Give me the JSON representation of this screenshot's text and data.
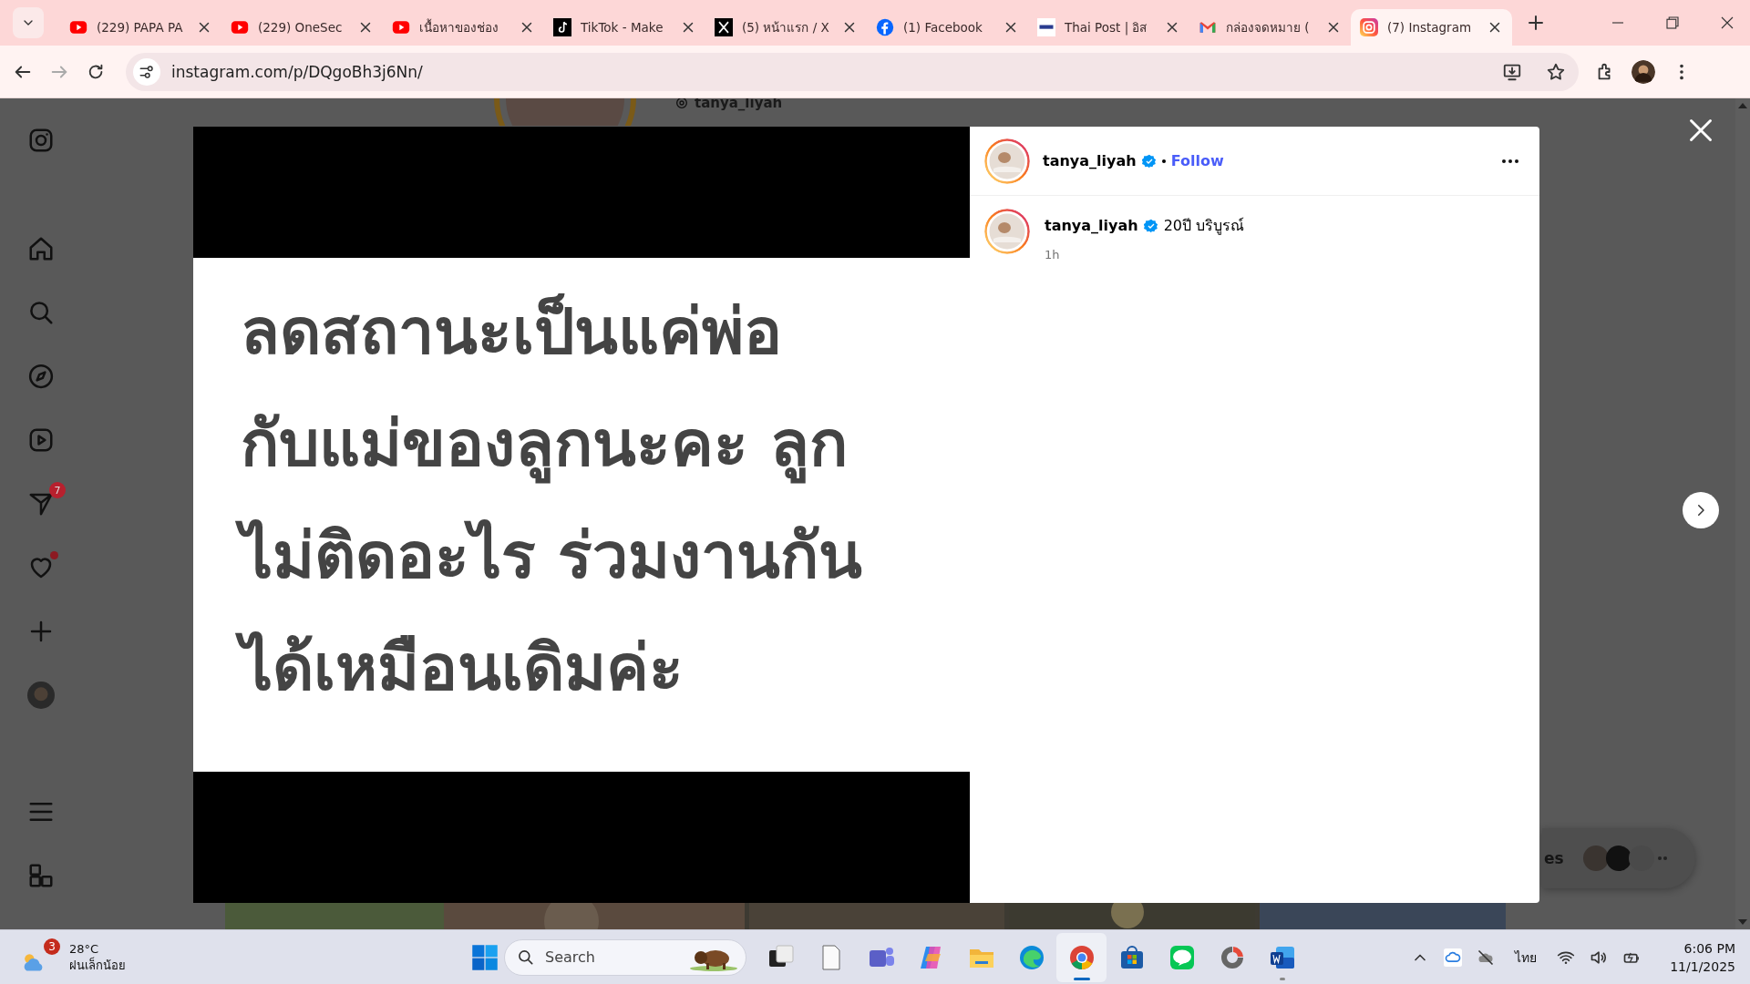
{
  "browser": {
    "tabs": [
      {
        "kind": "youtube",
        "title": "(229) PAPA PA",
        "selected": false
      },
      {
        "kind": "youtube",
        "title": "(229) OneSec",
        "selected": false
      },
      {
        "kind": "youtube",
        "title": "เนื้อหาของช่อง",
        "selected": false
      },
      {
        "kind": "tiktok",
        "title": "TikTok - Make",
        "selected": false
      },
      {
        "kind": "x",
        "title": "(5) หน้าแรก / X",
        "selected": false
      },
      {
        "kind": "facebook",
        "title": "(1) Facebook",
        "selected": false
      },
      {
        "kind": "news",
        "title": "Thai Post | อิส",
        "selected": false
      },
      {
        "kind": "mail",
        "title": "กล่องจดหมาย (",
        "selected": false
      },
      {
        "kind": "instagram",
        "title": "(7) Instagram",
        "selected": true
      }
    ],
    "address": "instagram.com/p/DQgoBh3j6Nn/"
  },
  "sidebar": {
    "messages_badge": "7",
    "notifications_unread": true
  },
  "background_page": {
    "profile_name": "tanya_liyah",
    "messages_label": "es"
  },
  "post": {
    "author": "tanya_liyah",
    "verified": true,
    "follow_label": "Follow",
    "image_text": [
      "ลดสถานะเป็นแค่พ่อ",
      "กับแม่ของลูกนะคะ ลูก",
      "ไม่ติดอะไร ร่วมงานกัน",
      "ได้เหมือนเดิมค่ะ"
    ],
    "comments": [
      {
        "author": "tanya_liyah",
        "verified": true,
        "text": "20ปี บริบูรณ์",
        "time": "1h"
      }
    ]
  },
  "taskbar": {
    "weather": {
      "badge": "3",
      "temperature": "28°C",
      "condition": "ฝนเล็กน้อย"
    },
    "search_placeholder": "Search",
    "apps": [
      {
        "kind": "taskview",
        "running": false,
        "active": false
      },
      {
        "kind": "file",
        "running": false,
        "active": false
      },
      {
        "kind": "teams",
        "running": false,
        "active": false
      },
      {
        "kind": "copilot",
        "running": false,
        "active": false
      },
      {
        "kind": "folder",
        "running": false,
        "active": false
      },
      {
        "kind": "edge",
        "running": false,
        "active": false
      },
      {
        "kind": "chrome",
        "running": true,
        "active": true
      },
      {
        "kind": "store",
        "running": false,
        "active": false
      },
      {
        "kind": "line",
        "running": false,
        "active": false
      },
      {
        "kind": "photoscape",
        "running": false,
        "active": false
      },
      {
        "kind": "word",
        "running": true,
        "active": false
      }
    ],
    "language": "ไทย",
    "time": "6:06 PM",
    "date": "11/1/2025"
  }
}
